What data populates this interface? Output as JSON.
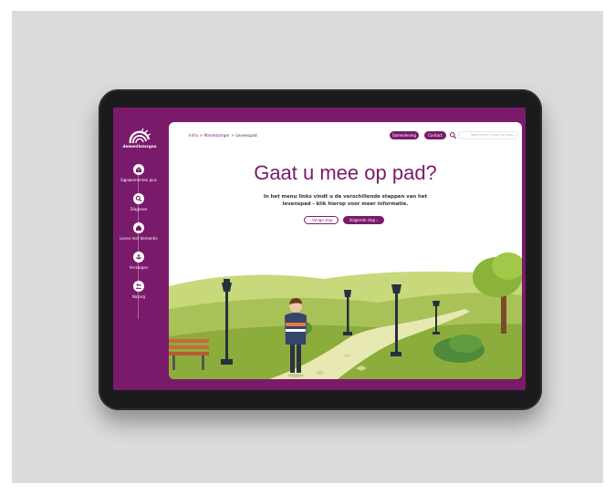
{
  "brand": {
    "logo_text": "dementiezorgnu",
    "accent": "#7a1a6a"
  },
  "sidebar": {
    "items": [
      {
        "label": "Signalementen plus",
        "icon": "house-exclamation-icon"
      },
      {
        "label": "Diagnose",
        "icon": "magnifier-icon"
      },
      {
        "label": "Leven met dementie",
        "icon": "house-icon"
      },
      {
        "label": "Verzorgen",
        "icon": "hands-icon"
      },
      {
        "label": "Nazorg",
        "icon": "people-icon"
      }
    ]
  },
  "header": {
    "breadcrumb": [
      "Infra",
      "Mantelzorger",
      "Levenspad"
    ],
    "buttons": {
      "samenleving": "Samenleving",
      "contact": "Contact"
    },
    "search_placeholder": "Waar bent u naar op zoek..."
  },
  "main": {
    "title": "Gaat u mee op pad?",
    "text": "In het menu links vindt u de verschillende stappen van het levenspad - klik hierop voor meer informatie.",
    "prev_label": "Vorige stap",
    "next_label": "Volgende stap"
  }
}
